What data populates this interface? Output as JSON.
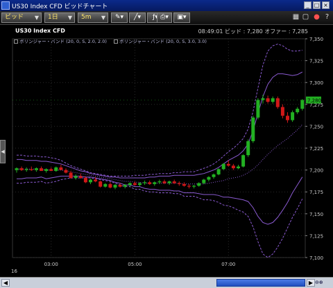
{
  "window": {
    "title": "US30 Index CFD ビッドチャート",
    "controls": [
      "_",
      "□",
      "×"
    ]
  },
  "toolbar": {
    "price_type": "ビッド",
    "period": "1日",
    "timeframe": "5m"
  },
  "chart": {
    "instrument": "US30 Index CFD",
    "time": "08:49:01",
    "bid_label": "ビッド :",
    "bid_value": "7,280",
    "offer_label": "オファー :",
    "offer_value": "7,285",
    "legend": [
      {
        "label": "ボリンジャー・バンド (20, 0, S, 2.0, 2.0)"
      },
      {
        "label": "ボリンジャー・バンド (20, 0, S, 3.0, 3.0)"
      }
    ],
    "y_ticks": [
      "7,350",
      "7,325",
      "7,300",
      "7,275",
      "7,250",
      "7,225",
      "7,200",
      "7,175",
      "7,150",
      "7,125",
      "7,100"
    ],
    "x_ticks": [
      "03:00",
      "05:00",
      "07:00"
    ],
    "date_label": "16",
    "last_price_tag": "7,280",
    "colors": {
      "up": "#22b022",
      "down": "#d01818",
      "band2": "#8a5ad0",
      "band3": "#8a5ad0",
      "grid": "#2a2a2a",
      "tag": "#22b022"
    }
  },
  "chart_data": {
    "type": "candlestick",
    "timeframe": "5m",
    "ylim": [
      7100,
      7350
    ],
    "candles": [
      [
        7200,
        7203,
        7197,
        7202
      ],
      [
        7202,
        7204,
        7199,
        7200
      ],
      [
        7200,
        7203,
        7198,
        7201
      ],
      [
        7201,
        7204,
        7199,
        7200
      ],
      [
        7200,
        7203,
        7198,
        7202
      ],
      [
        7202,
        7204,
        7199,
        7199
      ],
      [
        7199,
        7202,
        7197,
        7201
      ],
      [
        7201,
        7203,
        7199,
        7199
      ],
      [
        7199,
        7204,
        7198,
        7203
      ],
      [
        7203,
        7206,
        7200,
        7200
      ],
      [
        7200,
        7202,
        7196,
        7197
      ],
      [
        7197,
        7199,
        7190,
        7191
      ],
      [
        7191,
        7195,
        7189,
        7193
      ],
      [
        7193,
        7196,
        7190,
        7191
      ],
      [
        7191,
        7193,
        7185,
        7186
      ],
      [
        7186,
        7190,
        7184,
        7189
      ],
      [
        7189,
        7192,
        7186,
        7187
      ],
      [
        7187,
        7188,
        7180,
        7181
      ],
      [
        7181,
        7185,
        7180,
        7184
      ],
      [
        7184,
        7186,
        7179,
        7180
      ],
      [
        7180,
        7184,
        7178,
        7183
      ],
      [
        7183,
        7185,
        7180,
        7181
      ],
      [
        7181,
        7184,
        7179,
        7183
      ],
      [
        7183,
        7186,
        7181,
        7185
      ],
      [
        7185,
        7187,
        7182,
        7183
      ],
      [
        7183,
        7186,
        7181,
        7185
      ],
      [
        7185,
        7188,
        7183,
        7186
      ],
      [
        7186,
        7188,
        7183,
        7184
      ],
      [
        7184,
        7187,
        7182,
        7186
      ],
      [
        7186,
        7189,
        7184,
        7187
      ],
      [
        7187,
        7189,
        7184,
        7185
      ],
      [
        7185,
        7188,
        7183,
        7187
      ],
      [
        7187,
        7189,
        7184,
        7185
      ],
      [
        7185,
        7187,
        7182,
        7184
      ],
      [
        7184,
        7186,
        7181,
        7182
      ],
      [
        7182,
        7184,
        7179,
        7181
      ],
      [
        7181,
        7183,
        7179,
        7182
      ],
      [
        7182,
        7186,
        7181,
        7185
      ],
      [
        7185,
        7190,
        7184,
        7189
      ],
      [
        7189,
        7193,
        7187,
        7192
      ],
      [
        7192,
        7196,
        7190,
        7195
      ],
      [
        7195,
        7202,
        7194,
        7201
      ],
      [
        7201,
        7208,
        7200,
        7207
      ],
      [
        7207,
        7211,
        7204,
        7205
      ],
      [
        7205,
        7207,
        7200,
        7202
      ],
      [
        7202,
        7206,
        7201,
        7204
      ],
      [
        7204,
        7218,
        7203,
        7217
      ],
      [
        7217,
        7235,
        7215,
        7233
      ],
      [
        7233,
        7262,
        7231,
        7260
      ],
      [
        7260,
        7282,
        7258,
        7280
      ],
      [
        7280,
        7286,
        7276,
        7282
      ],
      [
        7282,
        7285,
        7276,
        7278
      ],
      [
        7278,
        7284,
        7276,
        7282
      ],
      [
        7282,
        7284,
        7270,
        7272
      ],
      [
        7272,
        7275,
        7259,
        7262
      ],
      [
        7262,
        7266,
        7254,
        7257
      ],
      [
        7257,
        7268,
        7255,
        7266
      ],
      [
        7266,
        7272,
        7264,
        7270
      ],
      [
        7270,
        7281,
        7268,
        7280
      ]
    ],
    "band_2_0": {
      "upper": [
        7212,
        7212,
        7211,
        7211,
        7211,
        7210,
        7210,
        7209,
        7208,
        7207,
        7205,
        7203,
        7201,
        7199,
        7198,
        7196,
        7195,
        7194,
        7193,
        7192,
        7192,
        7191,
        7191,
        7191,
        7191,
        7191,
        7191,
        7192,
        7192,
        7193,
        7193,
        7193,
        7194,
        7194,
        7194,
        7194,
        7194,
        7195,
        7196,
        7198,
        7200,
        7203,
        7207,
        7211,
        7214,
        7217,
        7222,
        7230,
        7245,
        7265,
        7284,
        7298,
        7306,
        7310,
        7310,
        7309,
        7308,
        7309,
        7312
      ],
      "middle": [
        7201,
        7201,
        7201,
        7201,
        7201,
        7201,
        7200,
        7200,
        7200,
        7200,
        7199,
        7198,
        7197,
        7196,
        7195,
        7194,
        7193,
        7192,
        7191,
        7190,
        7189,
        7188,
        7187,
        7187,
        7186,
        7186,
        7185,
        7185,
        7185,
        7185,
        7185,
        7185,
        7185,
        7185,
        7184,
        7184,
        7184,
        7184,
        7184,
        7185,
        7186,
        7187,
        7188,
        7190,
        7191,
        7192,
        7194,
        7197,
        7201,
        7206,
        7212,
        7218,
        7223,
        7228,
        7232,
        7236,
        7241,
        7246,
        7252
      ],
      "lower": [
        7190,
        7190,
        7191,
        7191,
        7191,
        7192,
        7190,
        7191,
        7192,
        7193,
        7193,
        7193,
        7193,
        7193,
        7192,
        7192,
        7191,
        7190,
        7189,
        7188,
        7186,
        7185,
        7183,
        7183,
        7181,
        7181,
        7179,
        7178,
        7178,
        7177,
        7177,
        7177,
        7176,
        7176,
        7174,
        7174,
        7174,
        7173,
        7172,
        7172,
        7172,
        7171,
        7169,
        7169,
        7168,
        7167,
        7166,
        7164,
        7157,
        7147,
        7140,
        7138,
        7140,
        7146,
        7154,
        7163,
        7174,
        7183,
        7192
      ]
    },
    "band_3_0": {
      "upper": [
        7217,
        7217,
        7216,
        7216,
        7216,
        7215,
        7215,
        7214,
        7213,
        7211,
        7208,
        7205,
        7203,
        7201,
        7199,
        7197,
        7196,
        7195,
        7194,
        7193,
        7193,
        7193,
        7193,
        7193,
        7194,
        7194,
        7194,
        7195,
        7195,
        7196,
        7196,
        7196,
        7197,
        7197,
        7198,
        7198,
        7198,
        7200,
        7202,
        7204,
        7207,
        7211,
        7216,
        7221,
        7225,
        7230,
        7236,
        7247,
        7267,
        7294,
        7320,
        7336,
        7342,
        7344,
        7342,
        7338,
        7336,
        7336,
        7337
      ],
      "lower": [
        7185,
        7185,
        7186,
        7186,
        7186,
        7187,
        7185,
        7186,
        7187,
        7189,
        7190,
        7191,
        7191,
        7191,
        7191,
        7191,
        7190,
        7189,
        7188,
        7187,
        7185,
        7183,
        7181,
        7181,
        7178,
        7178,
        7176,
        7175,
        7175,
        7174,
        7174,
        7174,
        7173,
        7173,
        7170,
        7170,
        7170,
        7168,
        7166,
        7166,
        7165,
        7163,
        7160,
        7159,
        7157,
        7154,
        7152,
        7147,
        7135,
        7118,
        7104,
        7100,
        7104,
        7112,
        7122,
        7134,
        7146,
        7156,
        7167
      ]
    }
  }
}
